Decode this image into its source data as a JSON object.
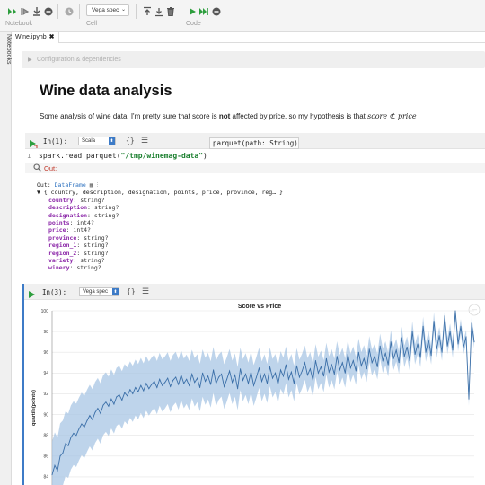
{
  "toolbar": {
    "groups": [
      {
        "label": "Notebook"
      },
      {
        "label": "Cell"
      },
      {
        "label": "Code"
      }
    ],
    "cell_type": "Vega spec",
    "icons": [
      "run-all-icon",
      "run-from-icon",
      "save-icon",
      "stop-icon",
      "history-icon",
      "insert-above-icon",
      "insert-below-icon",
      "delete-icon",
      "run-icon",
      "run-to-end-icon",
      "stop-run-icon"
    ]
  },
  "sidebar": {
    "label": "Notebooks"
  },
  "tab": {
    "title": "Wine.ipynb",
    "close": "✖"
  },
  "notebook": {
    "config_label": "Configuration & dependencies",
    "title": "Wine data analysis",
    "intro": {
      "before": "Some analysis of wine data! I'm pretty sure that score is ",
      "bold": "not",
      "after": " affected by price, so my hypothesis is that ",
      "math": "score ⊄ price"
    }
  },
  "cell1": {
    "id": "In(1):",
    "language": "Scala",
    "tooltip": "parquet(path: String)",
    "line_number": "1",
    "code_prefix": "spark.read.parquet(",
    "code_string": "\"/tmp/winemag-data\"",
    "code_suffix": ")",
    "output_label": "Out:",
    "result": {
      "out_prefix": "Out:",
      "out_type": "DataFrame",
      "summary": "▼ { country, description, designation, points, price, province, reg… }",
      "fields": [
        {
          "name": "country",
          "type": "string?"
        },
        {
          "name": "description",
          "type": "string?"
        },
        {
          "name": "designation",
          "type": "string?"
        },
        {
          "name": "points",
          "type": "int4?"
        },
        {
          "name": "price",
          "type": "int4?"
        },
        {
          "name": "province",
          "type": "string?"
        },
        {
          "name": "region_1",
          "type": "string?"
        },
        {
          "name": "region_2",
          "type": "string?"
        },
        {
          "name": "variety",
          "type": "string?"
        },
        {
          "name": "winery",
          "type": "string?"
        }
      ]
    }
  },
  "cell2": {
    "id": "In(3):",
    "language": "Vega spec",
    "more": "···"
  },
  "chart_data": {
    "type": "line",
    "title": "Score vs Price",
    "ylabel": "quartile(points)",
    "xlabel": "",
    "ylim": [
      82,
      100
    ],
    "yticks": [
      82,
      84,
      86,
      88,
      90,
      92,
      94,
      96,
      98,
      100
    ],
    "grid": true,
    "series": [
      {
        "name": "",
        "color": "#3b6fa8",
        "band_color": "#a8c6e4",
        "values": [
          84.2,
          85.1,
          84.6,
          86.0,
          86.3,
          87.2,
          87.0,
          87.8,
          88.2,
          88.0,
          88.6,
          89.1,
          88.8,
          89.4,
          89.9,
          89.5,
          90.2,
          90.6,
          90.1,
          90.9,
          91.2,
          90.8,
          91.5,
          91.0,
          91.7,
          91.9,
          91.4,
          92.1,
          91.8,
          92.4,
          92.0,
          92.6,
          92.2,
          92.8,
          92.3,
          93.0,
          92.5,
          92.9,
          93.2,
          92.6,
          93.4,
          92.8,
          93.1,
          93.5,
          92.7,
          93.3,
          93.6,
          92.9,
          93.8,
          93.0,
          93.4,
          92.8,
          93.9,
          93.1,
          93.5,
          92.6,
          94.0,
          93.2,
          93.7,
          92.9,
          94.3,
          93.0,
          93.6,
          93.9,
          92.7,
          93.4,
          94.2,
          93.1,
          93.8,
          92.5,
          94.4,
          93.3,
          93.9,
          93.0,
          94.1,
          92.8,
          93.6,
          94.5,
          93.2,
          93.9,
          93.0,
          94.6,
          93.5,
          94.0,
          92.9,
          94.3,
          93.7,
          94.8,
          93.4,
          94.1,
          93.0,
          94.7,
          93.6,
          94.2,
          95.0,
          93.8,
          94.4,
          93.3,
          95.2,
          94.0,
          94.6,
          93.7,
          95.4,
          94.1,
          94.8,
          93.9,
          95.6,
          94.3,
          95.0,
          94.0,
          95.8,
          94.5,
          95.2,
          94.2,
          96.0,
          94.7,
          95.4,
          94.4,
          96.3,
          95.0,
          95.6,
          94.6,
          96.6,
          95.2,
          95.9,
          94.8,
          97.0,
          95.4,
          96.2,
          95.0,
          97.4,
          95.6,
          96.5,
          95.2,
          98.0,
          95.8,
          96.8,
          95.5,
          98.5,
          96.0,
          97.2,
          95.7,
          99.0,
          96.3,
          97.6,
          96.0,
          99.5,
          96.6,
          98.0,
          96.2,
          100.0,
          96.8,
          98.5,
          96.5,
          97.5,
          91.5,
          98.8,
          97.0
        ]
      }
    ]
  }
}
